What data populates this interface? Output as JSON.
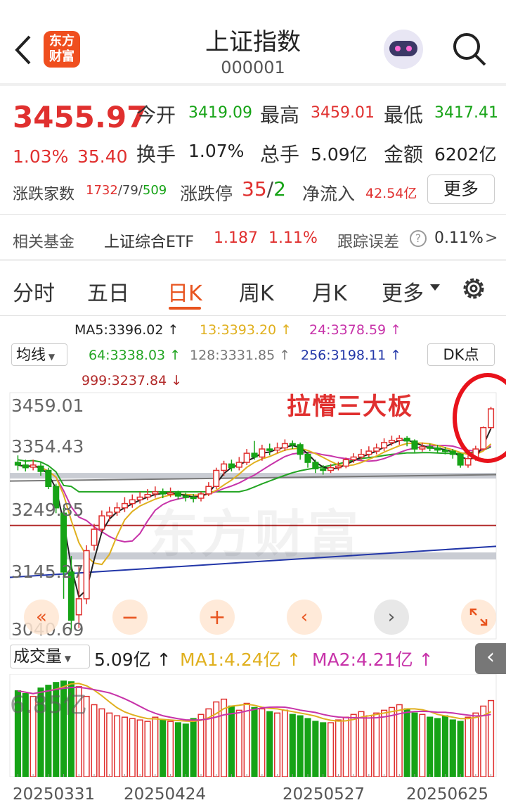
{
  "header": {
    "title": "上证指数",
    "code": "000001",
    "logo_text": "东方财富"
  },
  "quote": {
    "price": "3455.97",
    "pct": "1.03%",
    "chg": "35.40",
    "open_label": "今开",
    "open": "3419.09",
    "high_label": "最高",
    "high": "3459.01",
    "low_label": "最低",
    "low": "3417.41",
    "turnover_label": "换手",
    "turnover": "1.07%",
    "volume_label": "总手",
    "volume": "5.09亿",
    "amount_label": "金额",
    "amount": "6202亿",
    "breadth_label": "涨跌家数",
    "breadth_up": "1732",
    "breadth_flat": "79",
    "breadth_down": "509",
    "slash": "/",
    "limit_label": "涨跌停",
    "limit_up": "35",
    "limit_down": "2",
    "inflow_label": "净流入",
    "inflow": "42.54亿",
    "more": "更多"
  },
  "fund": {
    "label": "相关基金",
    "name": "上证综合ETF",
    "price": "1.187",
    "pct": "1.11%",
    "track_label": "跟踪误差",
    "track": "0.11%",
    "arrow": ">"
  },
  "tabs": [
    "分时",
    "五日",
    "日K",
    "周K",
    "月K",
    "更多"
  ],
  "indicators": {
    "ma_select": "均线",
    "dk": "DK点",
    "ma5": "MA5:3396.02",
    "ma13": "13:3393.20",
    "ma24": "24:3378.59",
    "ma64": "64:3338.03",
    "ma128": "128:3331.85",
    "ma256": "256:3198.11",
    "ma999": "999:3237.84",
    "up": "↑",
    "down": "↓"
  },
  "annotation": "拉懵三大板",
  "watermark": "东方财富",
  "chart_data": {
    "type": "candlestick",
    "y_ticks": [
      "3459.01",
      "3354.43",
      "3249.85",
      "3145.27",
      "3040.69"
    ],
    "ylim": [
      3040.69,
      3459.01
    ],
    "x_labels": [
      "20250331",
      "20250424",
      "20250527",
      "20250625"
    ],
    "candles": [
      [
        3355,
        3350,
        3368,
        3340
      ],
      [
        3350,
        3345,
        3360,
        3338
      ],
      [
        3346,
        3350,
        3360,
        3340
      ],
      [
        3348,
        3338,
        3355,
        3330
      ],
      [
        3340,
        3310,
        3345,
        3305
      ],
      [
        3310,
        3270,
        3315,
        3260
      ],
      [
        3260,
        3150,
        3270,
        3100
      ],
      [
        3150,
        3060,
        3180,
        3040
      ],
      [
        3070,
        3100,
        3160,
        3045
      ],
      [
        3100,
        3190,
        3200,
        3090
      ],
      [
        3200,
        3230,
        3240,
        3190
      ],
      [
        3230,
        3255,
        3265,
        3225
      ],
      [
        3255,
        3262,
        3272,
        3245
      ],
      [
        3262,
        3270,
        3280,
        3255
      ],
      [
        3270,
        3278,
        3290,
        3262
      ],
      [
        3278,
        3285,
        3295,
        3270
      ],
      [
        3285,
        3290,
        3300,
        3278
      ],
      [
        3290,
        3295,
        3305,
        3284
      ],
      [
        3296,
        3300,
        3310,
        3289
      ],
      [
        3300,
        3296,
        3306,
        3288
      ],
      [
        3296,
        3298,
        3308,
        3290
      ],
      [
        3298,
        3292,
        3302,
        3286
      ],
      [
        3292,
        3290,
        3298,
        3282
      ],
      [
        3290,
        3288,
        3296,
        3280
      ],
      [
        3288,
        3296,
        3300,
        3282
      ],
      [
        3296,
        3310,
        3318,
        3292
      ],
      [
        3310,
        3340,
        3345,
        3305
      ],
      [
        3340,
        3352,
        3358,
        3330
      ],
      [
        3352,
        3345,
        3360,
        3338
      ],
      [
        3346,
        3355,
        3365,
        3340
      ],
      [
        3355,
        3372,
        3380,
        3350
      ],
      [
        3372,
        3365,
        3395,
        3360
      ],
      [
        3365,
        3380,
        3388,
        3358
      ],
      [
        3380,
        3378,
        3390,
        3368
      ],
      [
        3378,
        3382,
        3392,
        3372
      ],
      [
        3382,
        3390,
        3398,
        3376
      ],
      [
        3390,
        3388,
        3396,
        3380
      ],
      [
        3388,
        3370,
        3392,
        3360
      ],
      [
        3370,
        3355,
        3375,
        3345
      ],
      [
        3355,
        3343,
        3360,
        3335
      ],
      [
        3343,
        3340,
        3350,
        3332
      ],
      [
        3340,
        3345,
        3352,
        3335
      ],
      [
        3345,
        3348,
        3356,
        3340
      ],
      [
        3348,
        3360,
        3364,
        3344
      ],
      [
        3360,
        3365,
        3372,
        3354
      ],
      [
        3365,
        3370,
        3380,
        3360
      ],
      [
        3370,
        3376,
        3385,
        3365
      ],
      [
        3376,
        3382,
        3390,
        3370
      ],
      [
        3382,
        3392,
        3400,
        3376
      ],
      [
        3392,
        3396,
        3405,
        3386
      ],
      [
        3396,
        3400,
        3406,
        3388
      ],
      [
        3400,
        3395,
        3404,
        3385
      ],
      [
        3395,
        3380,
        3398,
        3374
      ],
      [
        3380,
        3384,
        3392,
        3375
      ],
      [
        3384,
        3382,
        3390,
        3376
      ],
      [
        3382,
        3378,
        3388,
        3372
      ],
      [
        3378,
        3376,
        3384,
        3370
      ],
      [
        3376,
        3370,
        3380,
        3362
      ],
      [
        3370,
        3350,
        3372,
        3345
      ],
      [
        3350,
        3362,
        3368,
        3345
      ],
      [
        3362,
        3380,
        3386,
        3358
      ],
      [
        3380,
        3420,
        3422,
        3378
      ],
      [
        3420,
        3455,
        3459,
        3417
      ]
    ],
    "volume": {
      "label": "成交量",
      "value": "5.09亿",
      "ma1": "MA1:4.24亿",
      "ma2": "MA2:4.21亿",
      "max_label": "6.85亿"
    }
  }
}
